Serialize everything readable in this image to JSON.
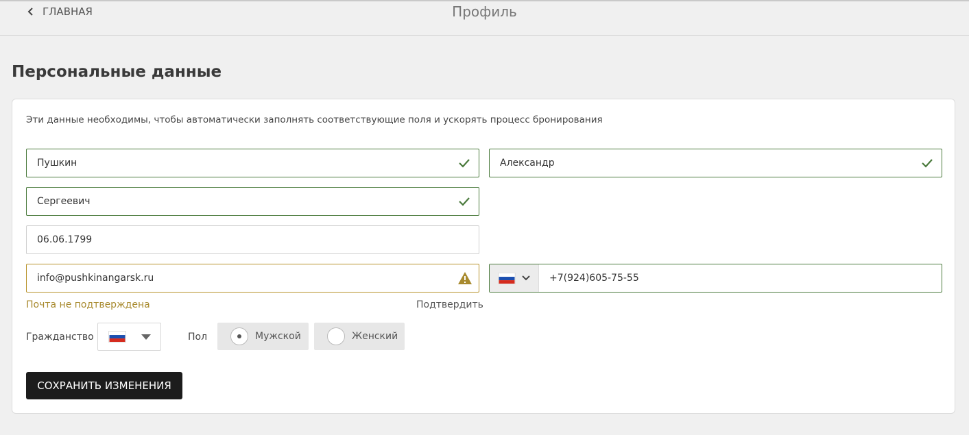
{
  "header": {
    "back_label": "ГЛАВНАЯ",
    "title": "Профиль"
  },
  "section": {
    "title": "Персональные данные",
    "description": "Эти данные необходимы, чтобы автоматически заполнять соответствующие поля и ускорять процесс бронирования"
  },
  "form": {
    "last_name": "Пушкин",
    "first_name": "Александр",
    "middle_name": "Сергеевич",
    "birth_date": "06.06.1799",
    "email": "info@pushkinangarsk.ru",
    "email_status": "Почта не подтверждена",
    "confirm_link": "Подтвердить",
    "phone": "+7(924)605-75-55",
    "phone_country_icon": "russia-flag-icon",
    "citizenship_label": "Гражданство",
    "citizenship_icon": "russia-flag-icon",
    "gender_label": "Пол",
    "gender_options": [
      "Мужской",
      "Женский"
    ],
    "gender_selected": "Мужской"
  },
  "actions": {
    "save_label": "СОХРАНИТЬ ИЗМЕНЕНИЯ"
  },
  "colors": {
    "valid": "#4a7a3c",
    "warning": "#b8922a",
    "button": "#1c1c1c"
  }
}
